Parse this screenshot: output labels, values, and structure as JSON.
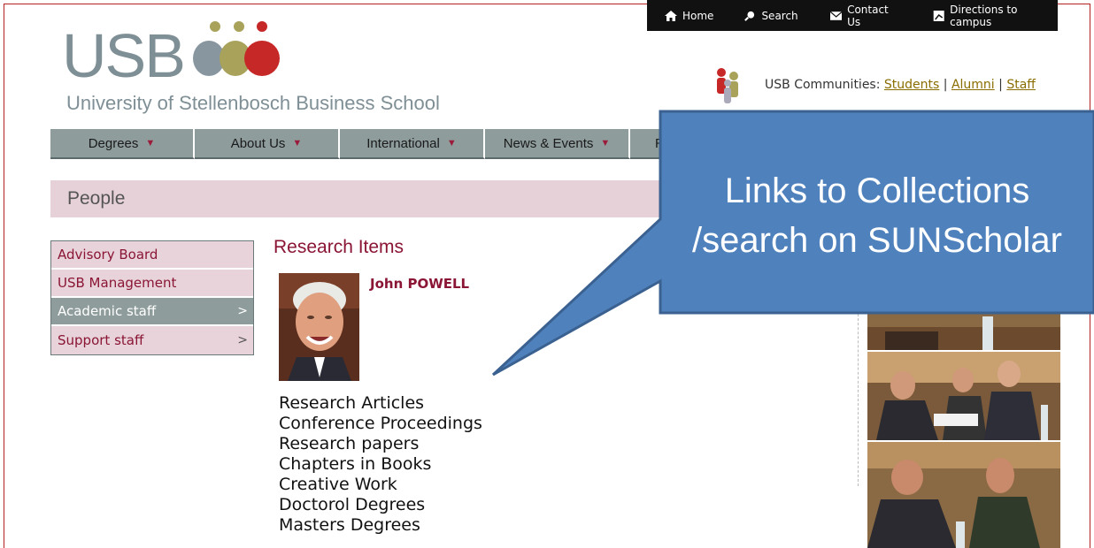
{
  "topbar": {
    "items": [
      {
        "label": "Home",
        "icon": "home-icon"
      },
      {
        "label": "Search",
        "icon": "search-icon"
      },
      {
        "label": "Contact Us",
        "icon": "mail-icon"
      },
      {
        "label": "Directions to campus",
        "icon": "map-icon"
      }
    ]
  },
  "logo": {
    "letters": "USB",
    "subtitle": "University of Stellenbosch Business School"
  },
  "communities": {
    "label": "USB Communities:",
    "links": [
      "Students",
      "Alumni",
      "Staff"
    ],
    "separator": "|"
  },
  "nav": {
    "items": [
      "Degrees",
      "About Us",
      "International",
      "News & Events",
      "R"
    ]
  },
  "section": {
    "title": "People"
  },
  "sidemenu": {
    "items": [
      {
        "label": "Advisory Board",
        "arrow": ""
      },
      {
        "label": "USB Management",
        "arrow": ""
      },
      {
        "label": "Academic staff",
        "arrow": ">"
      },
      {
        "label": "Support staff",
        "arrow": ">"
      }
    ]
  },
  "main": {
    "title": "Research Items",
    "person_name": "John POWELL",
    "links": [
      "Research Articles",
      "Conference Proceedings",
      "Research papers",
      "Chapters in Books",
      "Creative Work",
      "Doctorol Degrees",
      "Masters Degrees"
    ]
  },
  "callout": {
    "line1": "Links to Collections",
    "line2": "/search on SUNScholar",
    "color": "#4f81bd"
  },
  "colors": {
    "brand_maroon": "#8a1535",
    "nav_grey": "#8f9c9c",
    "section_pink": "#e6d1d8"
  }
}
